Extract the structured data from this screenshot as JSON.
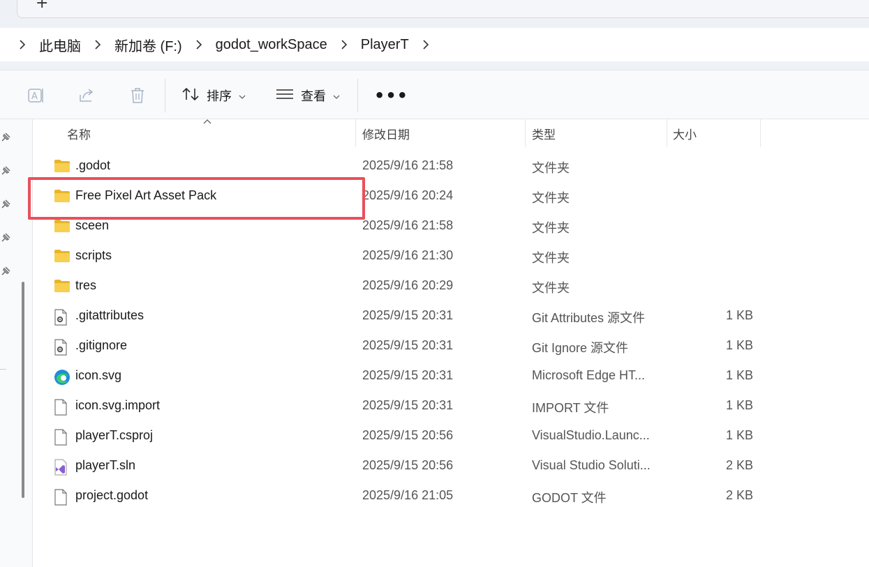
{
  "window": {
    "new_tab_label": "+"
  },
  "address": {
    "breadcrumbs": [
      "此电脑",
      "新加卷 (F:)",
      "godot_workSpace",
      "PlayerT"
    ]
  },
  "toolbar": {
    "sort_label": "排序",
    "view_label": "查看",
    "more_label": "•••"
  },
  "columns": {
    "name": "名称",
    "modified": "修改日期",
    "type": "类型",
    "size": "大小"
  },
  "files": [
    {
      "name": ".godot",
      "date": "2025/9/16 21:58",
      "type": "文件夹",
      "size": "",
      "icon": "folder-icon"
    },
    {
      "name": "Free Pixel Art Asset Pack",
      "date": "2025/9/16 20:24",
      "type": "文件夹",
      "size": "",
      "icon": "folder-icon"
    },
    {
      "name": "sceen",
      "date": "2025/9/16 21:58",
      "type": "文件夹",
      "size": "",
      "icon": "folder-icon"
    },
    {
      "name": "scripts",
      "date": "2025/9/16 21:30",
      "type": "文件夹",
      "size": "",
      "icon": "folder-icon"
    },
    {
      "name": "tres",
      "date": "2025/9/16 20:29",
      "type": "文件夹",
      "size": "",
      "icon": "folder-icon"
    },
    {
      "name": ".gitattributes",
      "date": "2025/9/15 20:31",
      "type": "Git Attributes 源文件",
      "size": "1 KB",
      "icon": "config-file-icon"
    },
    {
      "name": ".gitignore",
      "date": "2025/9/15 20:31",
      "type": "Git Ignore 源文件",
      "size": "1 KB",
      "icon": "config-file-icon"
    },
    {
      "name": "icon.svg",
      "date": "2025/9/15 20:31",
      "type": "Microsoft Edge HT...",
      "size": "1 KB",
      "icon": "edge-icon"
    },
    {
      "name": "icon.svg.import",
      "date": "2025/9/15 20:31",
      "type": "IMPORT 文件",
      "size": "1 KB",
      "icon": "file-icon"
    },
    {
      "name": "playerT.csproj",
      "date": "2025/9/15 20:56",
      "type": "VisualStudio.Launc...",
      "size": "1 KB",
      "icon": "file-icon"
    },
    {
      "name": "playerT.sln",
      "date": "2025/9/15 20:56",
      "type": "Visual Studio Soluti...",
      "size": "2 KB",
      "icon": "visual-studio-icon"
    },
    {
      "name": "project.godot",
      "date": "2025/9/16 21:05",
      "type": "GODOT 文件",
      "size": "2 KB",
      "icon": "file-icon"
    }
  ],
  "colors": {
    "highlight": "#e8505b",
    "folder": "#f6c945"
  }
}
